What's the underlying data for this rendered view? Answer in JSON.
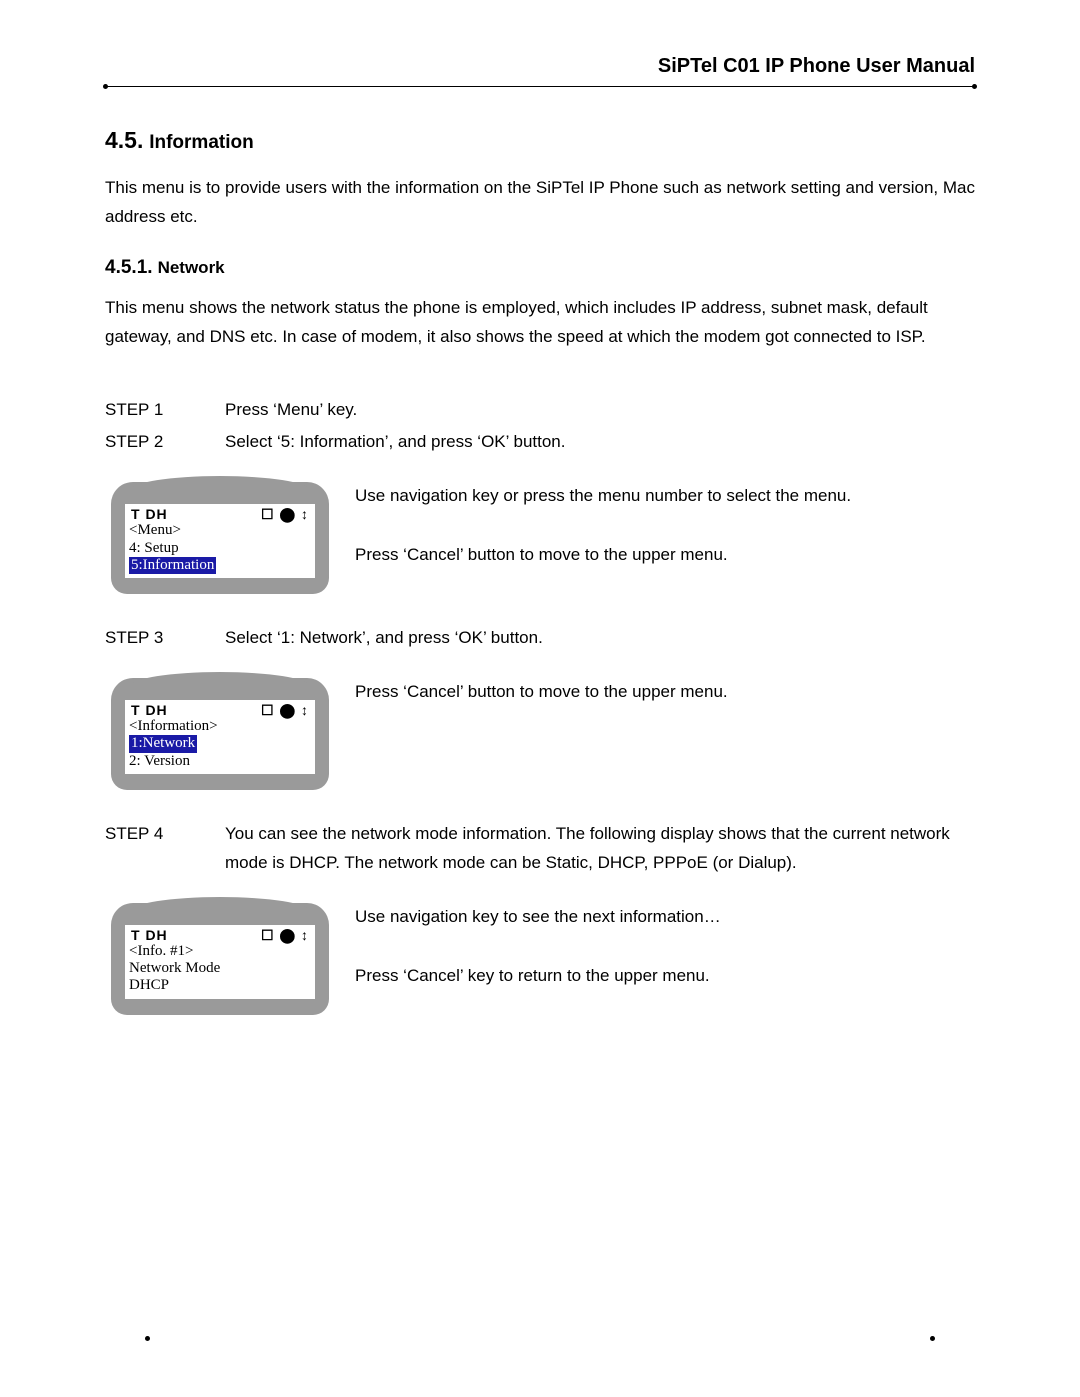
{
  "header": {
    "title": "SiPTel C01 IP Phone User Manual"
  },
  "section": {
    "num": "4.5.",
    "title": "Information",
    "intro": "This menu is to provide users with the information on the SiPTel IP Phone such as network setting and version, Mac address etc."
  },
  "subsection": {
    "num": "4.5.1.",
    "title": "Network",
    "intro": "This menu shows the network status the phone is employed, which includes IP address, subnet mask, default gateway, and DNS etc. In case of modem, it also shows the speed at which the modem got connected to ISP."
  },
  "steps": {
    "s1": {
      "label": "STEP 1",
      "text": "Press ‘Menu’ key."
    },
    "s2": {
      "label": "STEP 2",
      "text": "Select ‘5: Information’, and press ‘OK’ button."
    },
    "s3": {
      "label": "STEP 3",
      "text": "Select ‘1: Network’, and press ‘OK’ button."
    },
    "s4": {
      "label": "STEP 4",
      "text": "You can see the network mode information. The following display shows that the current network mode is DHCP. The network mode can be Static, DHCP, PPPoE (or Dialup)."
    }
  },
  "notes": {
    "n1a": "Use navigation key or press the menu number to select the menu.",
    "n1b": "Press ‘Cancel’ button to move to the upper menu.",
    "n2": "Press ‘Cancel’ button to move to the upper menu.",
    "n3a": "Use navigation key to see the next information…",
    "n3b": "Press ‘Cancel’ key to return to the upper menu."
  },
  "lcd_status": {
    "left": "T  DH",
    "right": "☐ ⬤ ↕"
  },
  "lcd1": {
    "title": "<Menu>",
    "row1": "4: Setup",
    "row2": "5:Information"
  },
  "lcd2": {
    "title": "<Information>",
    "row1": "1:Network",
    "row2": "2: Version"
  },
  "lcd3": {
    "title": "<Info. #1>",
    "row1": "Network Mode",
    "row2": "DHCP"
  }
}
